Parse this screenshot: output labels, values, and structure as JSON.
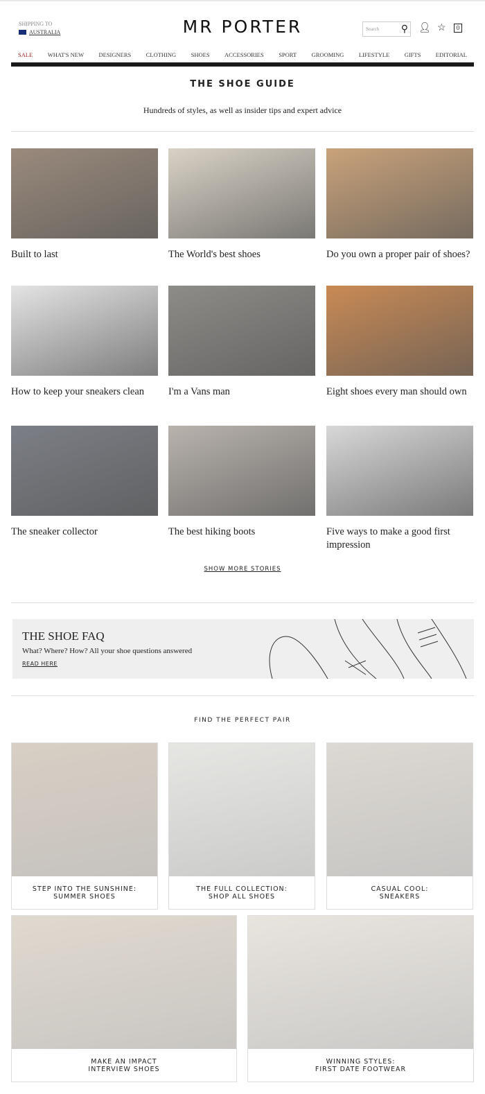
{
  "header": {
    "shipping_label": "SHIPPING TO",
    "country": "AUSTRALIA",
    "logo": "MR PORTER",
    "search_placeholder": "Search",
    "cart_count": "0"
  },
  "nav": [
    "SALE",
    "WHAT'S NEW",
    "DESIGNERS",
    "CLOTHING",
    "SHOES",
    "ACCESSORIES",
    "SPORT",
    "GROOMING",
    "LIFESTYLE",
    "GIFTS",
    "EDITORIAL"
  ],
  "page": {
    "title": "THE SHOE GUIDE",
    "subtitle": "Hundreds of styles, as well as insider tips and expert advice"
  },
  "stories": [
    {
      "caption": "Built to last",
      "color": "#9a8a7c"
    },
    {
      "caption": "The World's best shoes",
      "color": "#d9d2c6"
    },
    {
      "caption": "Do you own a proper pair of shoes?",
      "color": "#c9a27a"
    },
    {
      "caption": "How to keep your sneakers clean",
      "color": "#e4e4e4"
    },
    {
      "caption": "I'm a Vans man",
      "color": "#8e8c88"
    },
    {
      "caption": "Eight shoes every man should own",
      "color": "#c98a55"
    },
    {
      "caption": "The sneaker collector",
      "color": "#7c7f86"
    },
    {
      "caption": "The best hiking boots",
      "color": "#b9b3ad"
    },
    {
      "caption": "Five ways to make a good first impression",
      "color": "#d8d8d8"
    }
  ],
  "show_more": "SHOW MORE STORIES",
  "faq": {
    "title": "THE SHOE FAQ",
    "text": "What? Where? How? All your shoe questions answered",
    "link": "READ HERE"
  },
  "find_title": "FIND THE PERFECT PAIR",
  "products": [
    {
      "label": "STEP INTO THE SUNSHINE:\nSUMMER SHOES",
      "color": "#d8cfc4"
    },
    {
      "label": "THE FULL COLLECTION:\nSHOP ALL SHOES",
      "color": "#e6e6e3"
    },
    {
      "label": "CASUAL COOL:\nSNEAKERS",
      "color": "#dcd8d2"
    },
    {
      "label": "MAKE AN IMPACT\nINTERVIEW SHOES",
      "color": "#e0d9cf"
    },
    {
      "label": "WINNING STYLES:\nFIRST DATE FOOTWEAR",
      "color": "#e8e4de"
    }
  ]
}
